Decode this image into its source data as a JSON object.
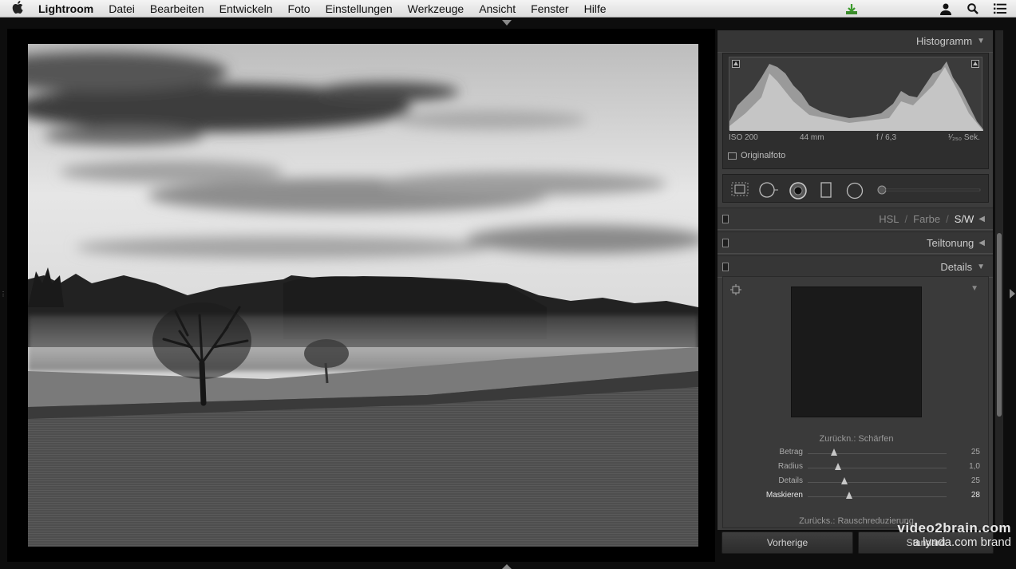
{
  "menubar": {
    "app": "Lightroom",
    "items": [
      "Datei",
      "Bearbeiten",
      "Entwickeln",
      "Foto",
      "Einstellungen",
      "Werkzeuge",
      "Ansicht",
      "Fenster",
      "Hilfe"
    ]
  },
  "panel": {
    "histogram": {
      "title": "Histogramm",
      "meta_left": "ISO 200",
      "meta_mid": "44 mm",
      "meta_aperture": "f / 6,3",
      "meta_shutter": "¹⁄₂₅₀ Sek.",
      "original_label": "Originalfoto"
    },
    "hsl_header": {
      "hsl": "HSL",
      "farbe": "Farbe",
      "sw": "S/W",
      "sep": "/"
    },
    "teiltonung": "Teiltonung",
    "details": {
      "title": "Details",
      "sharpen_title": "Zurückn.: Schärfen",
      "noise_title": "Zurücks.: Rauschreduzierung",
      "sliders": [
        {
          "label": "Betrag",
          "value": "25",
          "pos": 0.2
        },
        {
          "label": "Radius",
          "value": "1,0",
          "pos": 0.22
        },
        {
          "label": "Details",
          "value": "25",
          "pos": 0.27
        },
        {
          "label": "Maskieren",
          "value": "28",
          "pos": 0.3
        }
      ]
    },
    "buttons": {
      "previous": "Vorherige",
      "standard": "Standard"
    }
  },
  "watermark": {
    "line1": "video2brain.com",
    "line2": "a lynda.com brand"
  }
}
